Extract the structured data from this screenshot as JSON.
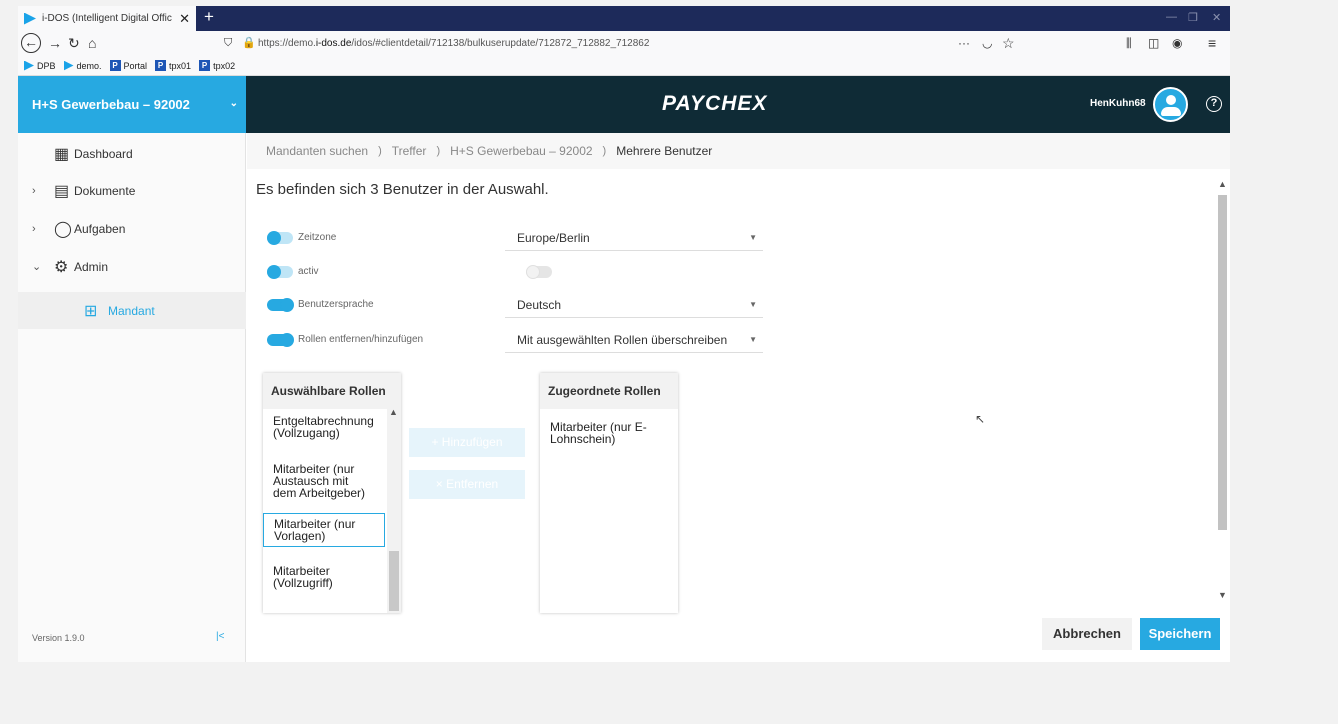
{
  "browser": {
    "tab_title": "i-DOS (Intelligent Digital Offic",
    "tab_close": "✕",
    "new_tab": "+",
    "url_prefix": "https://demo.",
    "url_domain": "i-dos.de",
    "url_path": "/idos/#clientdetail/712138/bulkuserupdate/712872_712882_712862",
    "url_actions": "···",
    "bookmarks": [
      "DPB",
      "demo.",
      "Portal",
      "tpx01",
      "tpx02"
    ]
  },
  "header": {
    "client_name": "H+S Gewerbebau – 92002",
    "logo": "PAYCHEX",
    "username": "HenKuhn68",
    "help": "?"
  },
  "sidebar": {
    "items": [
      {
        "label": "Dashboard",
        "icon": "dashboard-icon"
      },
      {
        "label": "Dokumente",
        "icon": "document-icon"
      },
      {
        "label": "Aufgaben",
        "icon": "tasks-icon"
      },
      {
        "label": "Admin",
        "icon": "gear-icon"
      },
      {
        "label": "Mandant",
        "icon": "client-icon"
      }
    ],
    "version": "Version 1.9.0",
    "collapse": "|<"
  },
  "breadcrumb": [
    "Mandanten suchen",
    "Treffer",
    "H+S Gewerbebau – 92002",
    "Mehrere Benutzer"
  ],
  "breadcrumb_sep": ")",
  "main": {
    "heading": "Es befinden sich 3 Benutzer in der Auswahl.",
    "settings": [
      {
        "label": "Zeitzone",
        "value": "Europe/Berlin",
        "enabled": false
      },
      {
        "label": "activ",
        "value": "",
        "enabled": false
      },
      {
        "label": "Benutzersprache",
        "value": "Deutsch",
        "enabled": true
      },
      {
        "label": "Rollen entfernen/hinzufügen",
        "value": "Mit ausgewählten Rollen überschreiben",
        "enabled": true
      }
    ],
    "available_roles": {
      "header": "Auswählbare Rollen",
      "items": [
        "Entgeltabrechnung (Vollzugang)",
        "Mitarbeiter (nur Austausch mit dem Arbeitgeber)",
        "Mitarbeiter (nur Vorlagen)",
        "Mitarbeiter (Vollzugriff)"
      ]
    },
    "assigned_roles": {
      "header": "Zugeordnete Rollen",
      "items": [
        "Mitarbeiter (nur E-Lohnschein)"
      ]
    },
    "add_button": "+ Hinzufügen",
    "remove_button": "× Entfernen",
    "cancel_button": "Abbrechen",
    "save_button": "Speichern"
  },
  "colors": {
    "accent": "#27a9e1",
    "header_bg": "#0f2b36",
    "tab_strip": "#1d2a5a"
  }
}
